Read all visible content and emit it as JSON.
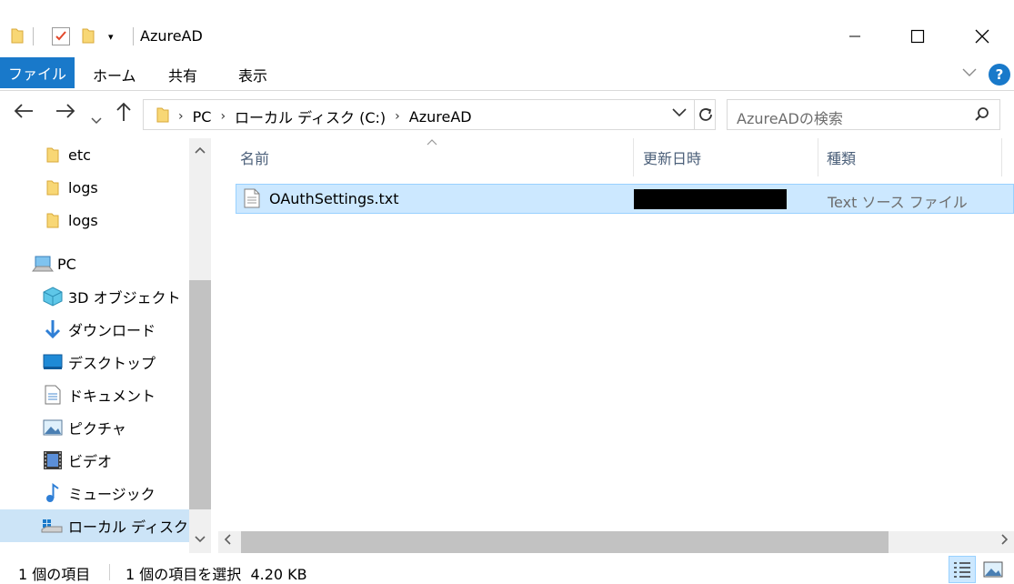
{
  "window": {
    "title": "AzureAD",
    "minimize_icon": "minimize-icon",
    "maximize_icon": "maximize-icon",
    "close_icon": "close-icon"
  },
  "ribbon": {
    "tabs": [
      "ファイル",
      "ホーム",
      "共有",
      "表示"
    ],
    "help": "?"
  },
  "address": {
    "crumbs": [
      "PC",
      "ローカル ディスク (C:)",
      "AzureAD"
    ],
    "search_placeholder": "AzureADの検索"
  },
  "nav": {
    "items": [
      {
        "label": "etc",
        "icon": "folder-icon"
      },
      {
        "label": "logs",
        "icon": "folder-icon"
      },
      {
        "label": "logs",
        "icon": "folder-icon"
      },
      {
        "label": "PC",
        "icon": "pc-icon"
      },
      {
        "label": "3D オブジェクト",
        "icon": "3d-objects-icon"
      },
      {
        "label": "ダウンロード",
        "icon": "download-icon"
      },
      {
        "label": "デスクトップ",
        "icon": "desktop-icon"
      },
      {
        "label": "ドキュメント",
        "icon": "documents-icon"
      },
      {
        "label": "ピクチャ",
        "icon": "pictures-icon"
      },
      {
        "label": "ビデオ",
        "icon": "videos-icon"
      },
      {
        "label": "ミュージック",
        "icon": "music-icon"
      },
      {
        "label": "ローカル ディスク (C:)",
        "icon": "local-disk-icon"
      }
    ]
  },
  "columns": {
    "name": "名前",
    "modified": "更新日時",
    "type": "種類"
  },
  "files": [
    {
      "name": "OAuthSettings.txt",
      "type": "Text ソース ファイル",
      "icon": "text-file-icon",
      "selected": true
    }
  ],
  "status": {
    "count": "1 個の項目",
    "selection": "1 個の項目を選択  4.20 KB"
  },
  "colors": {
    "accent": "#1979ca",
    "selection_bg": "#cce8ff",
    "selection_border": "#99d1ff",
    "nav_selected": "#cce4f7",
    "folder_yellow": "#f8d775"
  }
}
